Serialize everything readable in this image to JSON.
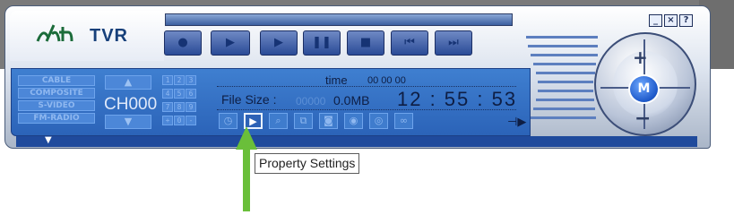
{
  "app": {
    "brand": "TVR",
    "logo_icon": "ht-logo"
  },
  "window_controls": {
    "minimize": "_",
    "close": "×",
    "help": "?"
  },
  "progress": {
    "fraction": 1.0
  },
  "transport": [
    {
      "name": "record-button",
      "glyph": "●"
    },
    {
      "name": "play-button",
      "glyph": "▶"
    },
    {
      "name": "play-file-button",
      "glyph": "▶"
    },
    {
      "name": "pause-button",
      "glyph": "❚❚"
    },
    {
      "name": "stop-button",
      "glyph": "■"
    },
    {
      "name": "previous-button",
      "glyph": "⏮"
    },
    {
      "name": "next-button",
      "glyph": "⏭"
    }
  ],
  "sources": [
    "CABLE",
    "COMPOSITE",
    "S-VIDEO",
    "FM-RADIO"
  ],
  "channel": {
    "label": "CH000",
    "up": "▲",
    "down": "▼"
  },
  "keypad": [
    "1",
    "2",
    "3",
    "4",
    "5",
    "6",
    "7",
    "8",
    "9",
    "+",
    "0",
    "-"
  ],
  "display": {
    "time_label": "time",
    "time_value": "00 00 00",
    "file_size_label": "File Size :",
    "file_size_zeros": "00000",
    "file_size_value": "0.0MB",
    "clock": "12 : 55 : 53"
  },
  "tools": [
    "◷",
    "▶",
    "⌕",
    "⧉",
    "◙",
    "◉",
    "◎",
    "∞"
  ],
  "dial": {
    "plus": "+",
    "minus": "−",
    "mode": "M"
  },
  "tooltip": {
    "text": "Property Settings"
  },
  "colors": {
    "panel": "#2b63b8",
    "callout_arrow": "#6abf3a"
  }
}
